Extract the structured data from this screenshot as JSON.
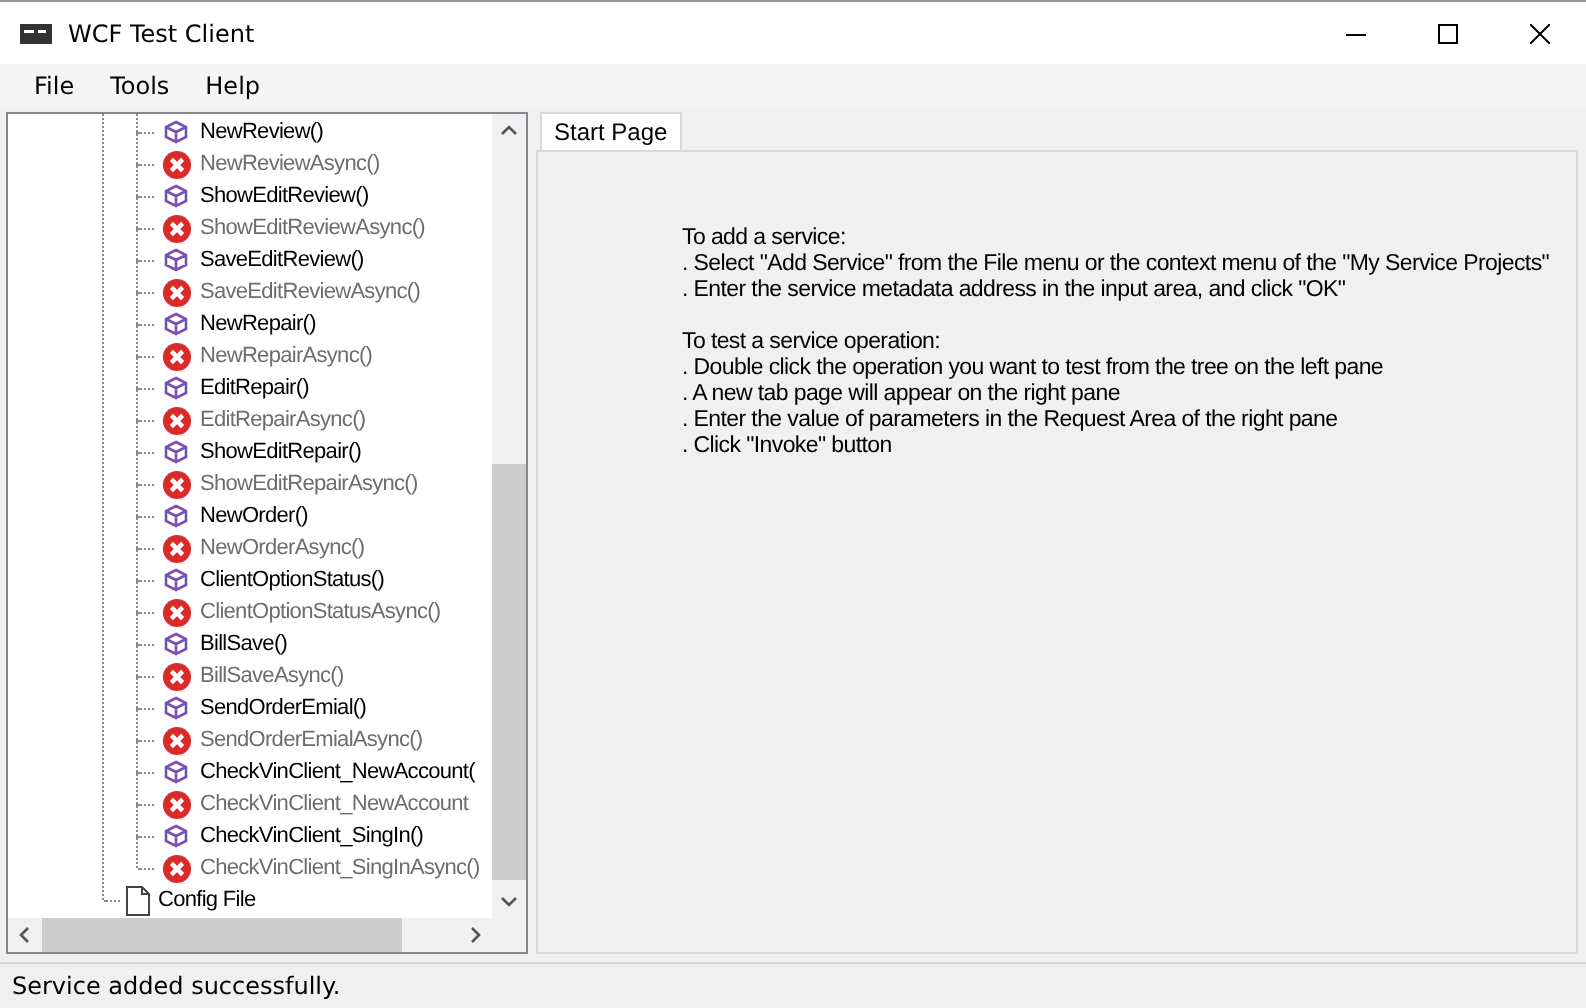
{
  "window": {
    "title": "WCF Test Client"
  },
  "menu": [
    "File",
    "Tools",
    "Help"
  ],
  "tree": {
    "items": [
      {
        "children": [
          {
            "label": "NewReview()",
            "kind": "operation"
          },
          {
            "label": "NewReviewAsync()",
            "kind": "unsupported"
          },
          {
            "label": "ShowEditReview()",
            "kind": "operation"
          },
          {
            "label": "ShowEditReviewAsync()",
            "kind": "unsupported"
          },
          {
            "label": "SaveEditReview()",
            "kind": "operation"
          },
          {
            "label": "SaveEditReviewAsync()",
            "kind": "unsupported"
          },
          {
            "label": "NewRepair()",
            "kind": "operation"
          },
          {
            "label": "NewRepairAsync()",
            "kind": "unsupported"
          },
          {
            "label": "EditRepair()",
            "kind": "operation"
          },
          {
            "label": "EditRepairAsync()",
            "kind": "unsupported"
          },
          {
            "label": "ShowEditRepair()",
            "kind": "operation"
          },
          {
            "label": "ShowEditRepairAsync()",
            "kind": "unsupported"
          },
          {
            "label": "NewOrder()",
            "kind": "operation"
          },
          {
            "label": "NewOrderAsync()",
            "kind": "unsupported"
          },
          {
            "label": "ClientOptionStatus()",
            "kind": "operation"
          },
          {
            "label": "ClientOptionStatusAsync()",
            "kind": "unsupported"
          },
          {
            "label": "BillSave()",
            "kind": "operation"
          },
          {
            "label": "BillSaveAsync()",
            "kind": "unsupported"
          },
          {
            "label": "SendOrderEmial()",
            "kind": "operation"
          },
          {
            "label": "SendOrderEmialAsync()",
            "kind": "unsupported"
          },
          {
            "label": "CheckVinClient_NewAccount(",
            "kind": "operation"
          },
          {
            "label": "CheckVinClient_NewAccount",
            "kind": "unsupported"
          },
          {
            "label": "CheckVinClient_SingIn()",
            "kind": "operation"
          },
          {
            "label": "CheckVinClient_SingInAsync()",
            "kind": "unsupported"
          }
        ]
      },
      {
        "label": "Config File",
        "kind": "file"
      }
    ]
  },
  "tabs": [
    {
      "label": "Start Page",
      "selected": true
    }
  ],
  "start_page": {
    "sections": [
      {
        "heading": "To add a service:",
        "lines": [
          ". Select \"Add Service\" from the File menu or the context menu of the \"My Service Projects\"",
          ". Enter the service metadata address in the input area, and click \"OK\""
        ]
      },
      {
        "heading": "To test a service operation:",
        "lines": [
          ". Double click the operation you want to test from the tree on the left pane",
          ". A new tab page will appear on the right pane",
          ". Enter the value of parameters in the Request Area of the right pane",
          ". Click \"Invoke\" button"
        ]
      }
    ]
  },
  "status_bar": {
    "text": "Service added successfully."
  }
}
